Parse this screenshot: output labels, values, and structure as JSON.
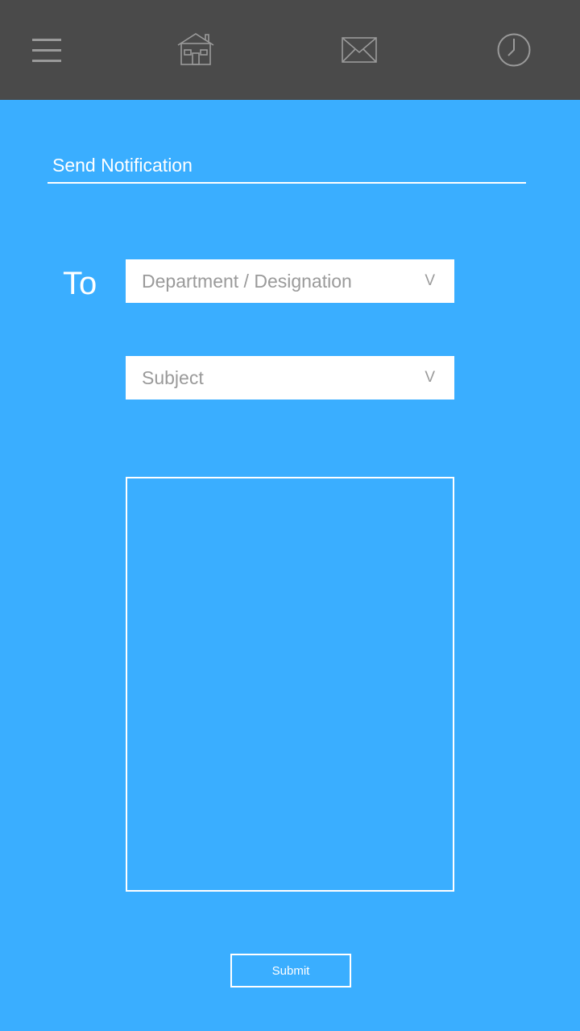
{
  "nav": {
    "icons": [
      "menu-icon",
      "home-icon",
      "mail-icon",
      "clock-icon"
    ]
  },
  "form": {
    "title": "Send Notification",
    "to_label": "To",
    "recipient_dropdown": {
      "placeholder": "Department / Designation",
      "arrow": "V"
    },
    "subject_dropdown": {
      "placeholder": "Subject",
      "arrow": "V"
    },
    "message_value": "",
    "submit_label": "Submit"
  },
  "colors": {
    "topbar": "#4A4A4A",
    "background": "#3AAEFF",
    "icon": "#9A9A9A",
    "text": "#FFFFFF",
    "placeholder": "#9A9A9A"
  }
}
